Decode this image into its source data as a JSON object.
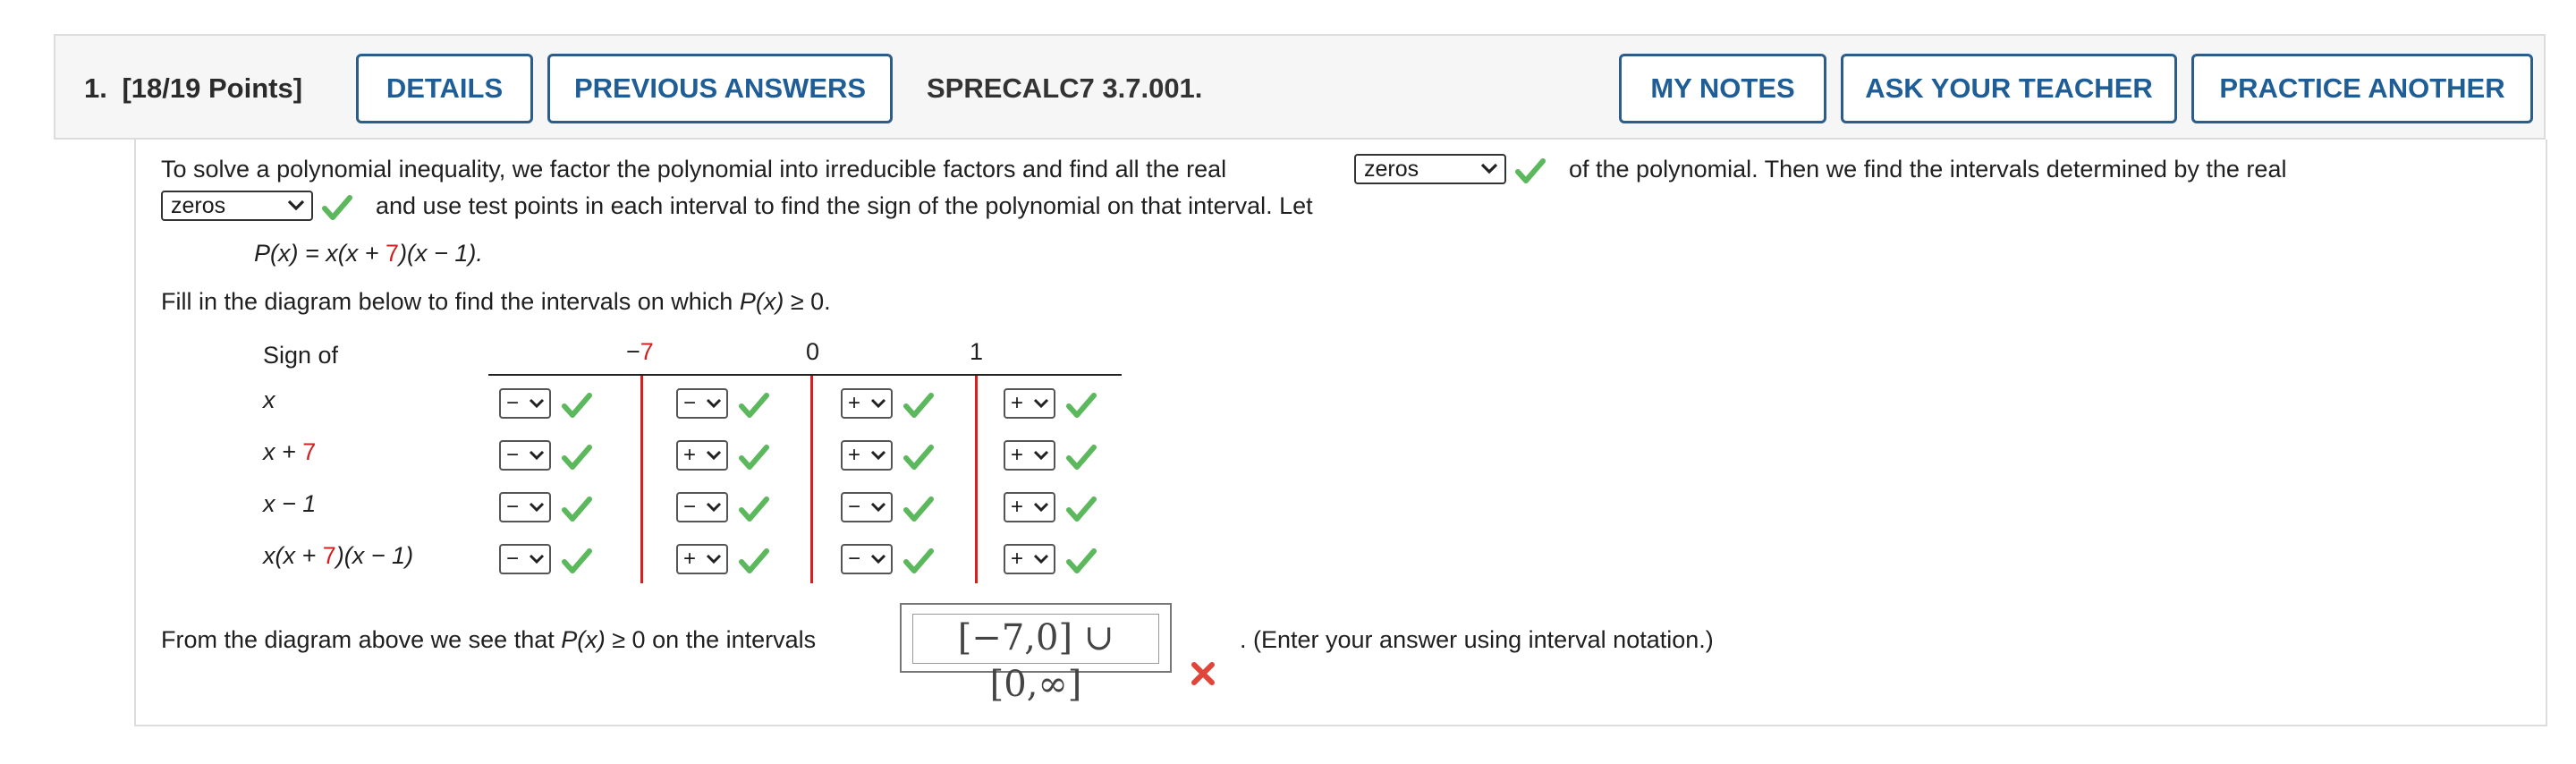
{
  "header": {
    "question_number": "1.",
    "points": "[18/19 Points]",
    "details_label": "DETAILS",
    "previous_answers_label": "PREVIOUS ANSWERS",
    "question_id": "SPRECALC7 3.7.001.",
    "my_notes_label": "MY NOTES",
    "ask_teacher_label": "ASK YOUR TEACHER",
    "practice_another_label": "PRACTICE ANOTHER"
  },
  "intro": {
    "line1_a": "To solve a polynomial inequality, we factor the polynomial into irreducible factors and find all the real",
    "select1_value": "zeros",
    "line1_b": "of the polynomial. Then we find the intervals determined by the real",
    "select2_value": "zeros",
    "line2_b": "and use test points in each interval to find the sign of the polynomial on that interval. Let"
  },
  "polynomial": {
    "lhs": "P(x) = x(x + ",
    "red_number": "7",
    "rhs": ")(x − 1)."
  },
  "fill_instruction": {
    "a": "Fill in the diagram below to find the intervals on which ",
    "b": "P(x)",
    "c": " ≥ 0."
  },
  "diagram": {
    "header_label": "Sign of",
    "boundary_minus_sign": "−",
    "boundary_1_number": "7",
    "boundary_2": "0",
    "boundary_3": "1",
    "rows": [
      {
        "label_a": "x",
        "label_red": "",
        "label_b": "",
        "signs": [
          "−",
          "−",
          "+",
          "+"
        ]
      },
      {
        "label_a": "x + ",
        "label_red": "7",
        "label_b": "",
        "signs": [
          "−",
          "+",
          "+",
          "+"
        ]
      },
      {
        "label_a": "x − 1",
        "label_red": "",
        "label_b": "",
        "signs": [
          "−",
          "−",
          "−",
          "+"
        ]
      },
      {
        "label_a": "x(x + ",
        "label_red": "7",
        "label_b": ")(x − 1)",
        "signs": [
          "−",
          "+",
          "−",
          "+"
        ]
      }
    ]
  },
  "answer": {
    "lead_a": "From the diagram above we see that ",
    "lead_b": "P(x)",
    "lead_c": " ≥ 0 on the intervals",
    "value": "[−7,0] ∪ [0,∞]",
    "trail": ". (Enter your answer using interval notation.)"
  },
  "colors": {
    "accent": "#1f5d96",
    "correct": "#5cb85c",
    "incorrect": "#e0453a",
    "highlight_red": "#d22020"
  },
  "icons": {
    "correct": "check-icon",
    "incorrect": "x-icon",
    "dropdown": "chevron-down-icon"
  }
}
